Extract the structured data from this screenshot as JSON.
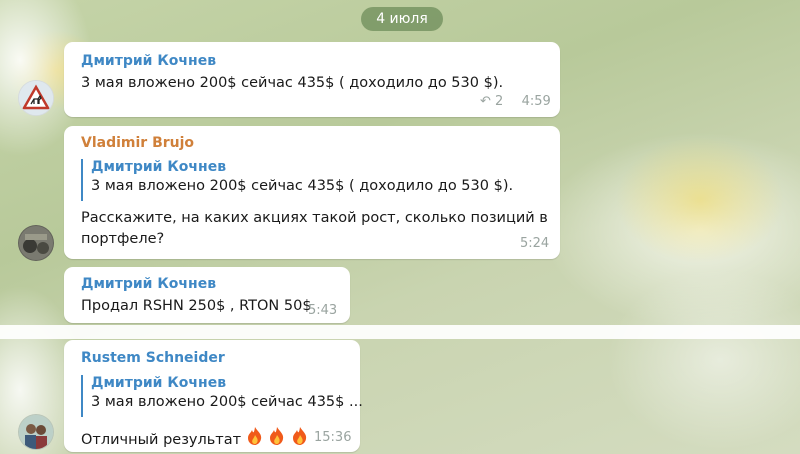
{
  "date_separator": "4 июля",
  "messages": [
    {
      "author": "Дмитрий Кочнев",
      "text": "3 мая вложено 200$ сейчас 435$  ( доходило до 530 $).",
      "replies": "2",
      "time": "4:59",
      "avatar_icon": "deer-crossing-sign"
    },
    {
      "author": "Vladimir Brujo",
      "quote_author": "Дмитрий Кочнев",
      "quote_text": "3 мая вложено 200$ сейчас 435$  ( доходило до 530 $).",
      "text_line1": "Расскажите, на каких акциях такой рост, сколько позиций в",
      "text_line2": "портфеле?",
      "time": "5:24",
      "avatar_icon": "dark-photo"
    },
    {
      "author": "Дмитрий Кочнев",
      "text": "Продал RSHN 250$ , RTON 50$",
      "time": "5:43"
    },
    {
      "author": "Rustem Schneider",
      "quote_author": "Дмитрий Кочнев",
      "quote_text": "3 мая вложено 200$ сейчас 435$  ...",
      "text": "Отличный результат",
      "emoji": "fire fire fire",
      "time": "15:36",
      "avatar_icon": "people-photo"
    }
  ],
  "colors": {
    "name_blue": "#3f88c5",
    "name_orange": "#d0803a",
    "meta_gray": "#9aa4a0",
    "bubble_bg": "#ffffff"
  }
}
